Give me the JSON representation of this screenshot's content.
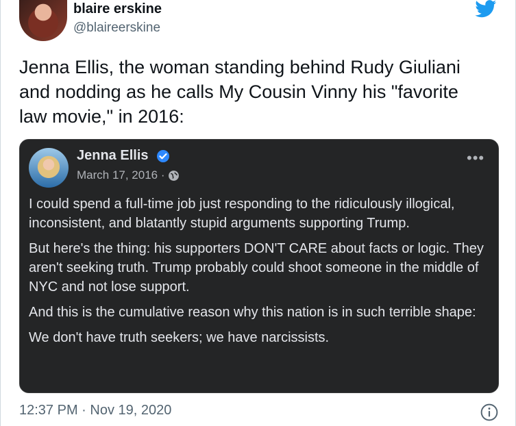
{
  "author": {
    "display_name": "blaire erskine",
    "handle": "@blaireerskine"
  },
  "tweet": {
    "text": "Jenna Ellis, the woman standing behind Rudy Giuliani\nand nodding as he calls My Cousin Vinny his \"favorite\nlaw movie,\" in 2016:",
    "timestamp": "12:37 PM · Nov 19, 2020"
  },
  "embedded_post": {
    "name": "Jenna Ellis",
    "date": "March 17, 2016 ·",
    "paragraphs": [
      "I could spend a full-time job just responding to the ridiculously illogical, inconsistent, and blatantly stupid arguments supporting Trump.",
      "But here's the thing: his supporters DON'T CARE about facts or logic. They aren't seeking truth. Trump probably could shoot someone in the middle of NYC and not lose support.",
      "And this is the cumulative reason why this nation is in such terrible shape:",
      "We don't have truth seekers; we have narcissists."
    ]
  },
  "colors": {
    "twitter_blue": "#1d9bf0",
    "fb_card_bg": "#242526",
    "fb_verified": "#2d88ff"
  },
  "icons": {
    "brand": "twitter-bird-icon",
    "verified": "verified-badge-icon",
    "privacy": "globe-icon",
    "menu": "more-options-icon",
    "info": "info-icon"
  }
}
